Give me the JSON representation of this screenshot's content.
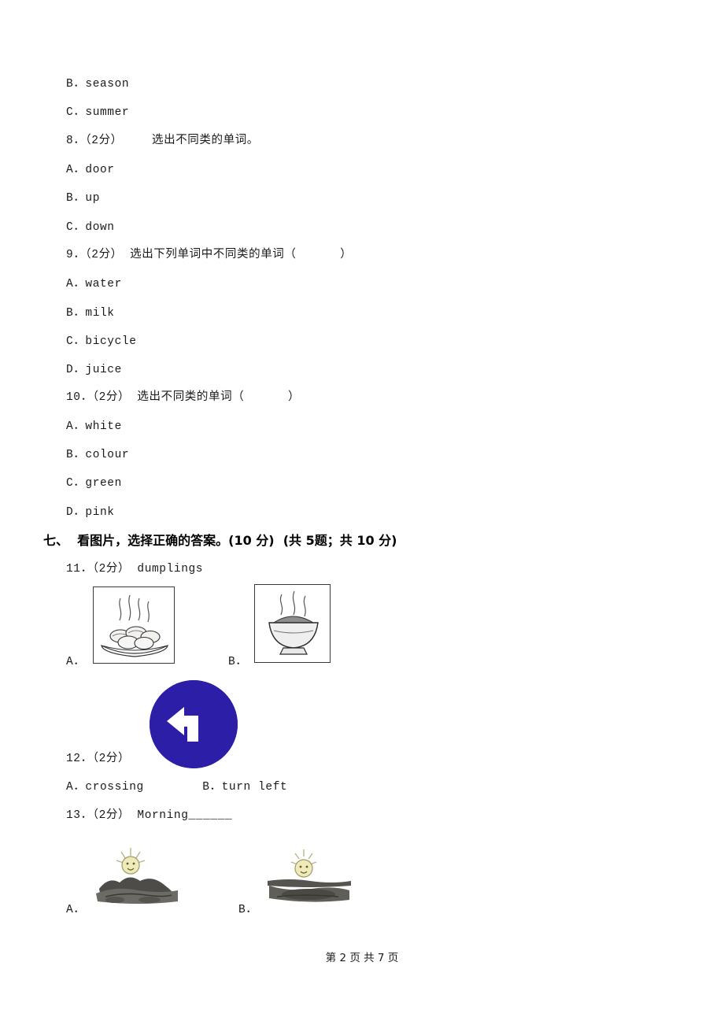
{
  "page": {
    "footer": "第 2 页 共 7 页",
    "footer_page": "2",
    "footer_total": "7"
  },
  "top_options": [
    {
      "label": "B．season"
    },
    {
      "label": "C．summer"
    }
  ],
  "questions": [
    {
      "number": "8",
      "marks": "（2分）",
      "stem": "选出不同类的单词。",
      "options": [
        {
          "label": "A．door"
        },
        {
          "label": "B．up"
        },
        {
          "label": "C．down"
        }
      ]
    },
    {
      "number": "9",
      "marks": "（2分）",
      "stem": "选出下列单词中不同类的单词（      ）",
      "options": [
        {
          "label": "A．water"
        },
        {
          "label": "B．milk"
        },
        {
          "label": "C．bicycle"
        },
        {
          "label": "D．juice"
        }
      ]
    },
    {
      "number": "10",
      "marks": "（2分）",
      "stem": "选出不同类的单词（      ）",
      "options": [
        {
          "label": "A．white"
        },
        {
          "label": "B．colour"
        },
        {
          "label": "C．green"
        },
        {
          "label": "D．pink"
        }
      ]
    }
  ],
  "section": {
    "title": "七、  看图片，选择正确的答案。(10 分)  (共 5题；共 10 分)"
  },
  "picture_questions": [
    {
      "number": "11",
      "marks": "（2分）",
      "stem": "dumplings",
      "option_a_label": "A．",
      "option_b_label": "B．",
      "image_a_alt": "plate-of-dumplings-illustration",
      "image_b_alt": "bowl-of-noodles-illustration"
    },
    {
      "number": "12",
      "marks": "（2分）",
      "stem": "",
      "sign_alt": "turn-left-road-sign",
      "answers": "A．crossing        B．turn left",
      "answer_a": "A．crossing",
      "answer_b": "B．turn left"
    },
    {
      "number": "13",
      "marks": "（2分）",
      "stem": "Morning______",
      "option_a_label": "A．",
      "option_b_label": "B．",
      "image_a_alt": "sunrise-over-hills-photo",
      "image_b_alt": "sunset-over-water-photo"
    }
  ],
  "colors": {
    "sign_blue": "#2d1ea8",
    "text": "#1a1a1a"
  }
}
